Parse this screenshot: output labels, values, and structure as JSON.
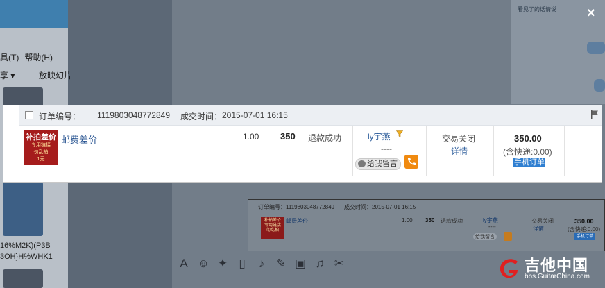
{
  "background": {
    "menu": [
      "具(T)",
      "帮助(H)"
    ],
    "share": "享 ▾",
    "slideshow": "放映幻片",
    "code_lines": [
      "16%M2K)(P3B",
      "3OH}H%WHK1"
    ],
    "toolbar_icons": [
      "font-icon",
      "emoji-icon",
      "magic-icon",
      "screenshot-icon",
      "mic-icon",
      "edit-icon",
      "image-icon",
      "music-icon",
      "scissors-icon"
    ],
    "chat_snippet": "看见了的话请说"
  },
  "dialog": {
    "close_glyph": "×"
  },
  "order": {
    "order_label": "订单编号：",
    "order_no": "1119803048772849",
    "time_label": "成交时间：",
    "time_value": "2015-07-01 16:15",
    "item": {
      "thumb_line1": "补拍差价",
      "thumb_line2": "专用链接",
      "thumb_line3": "勿乱拍",
      "thumb_line4": "1元",
      "name": "邮费差价",
      "quantity": "1.00",
      "price": "350",
      "refund_status": "退款成功"
    },
    "buyer": {
      "name": "ly宇燕",
      "placeholder": "----",
      "leave_message": "给我留言"
    },
    "trade": {
      "status": "交易关闭",
      "detail": "详情"
    },
    "amount": {
      "total": "350.00",
      "shipping": "(含快递:0.00)",
      "mobile_order": "手机订单"
    }
  },
  "mini_preview": {
    "order_label": "订单编号：1119803048772849",
    "time_label": "成交时间：2015-07-01 16:15",
    "name": "邮费差价",
    "quantity": "1.00",
    "price": "350",
    "refund_status": "退款成功",
    "buyer": "ly宇燕",
    "placeholder": "----",
    "leave_message": "给我留言",
    "status": "交易关闭",
    "detail": "详情",
    "total": "350.00",
    "shipping": "(含快递:0.00)",
    "mobile_order": "手机订单"
  },
  "watermark": {
    "cn": "吉他中国",
    "en": "bbs.GuitarChina.com"
  },
  "colors": {
    "link": "#23508f",
    "phone": "#f08a10",
    "mobile_badge": "#2f7fd1",
    "thumb": "#a51c1c"
  }
}
